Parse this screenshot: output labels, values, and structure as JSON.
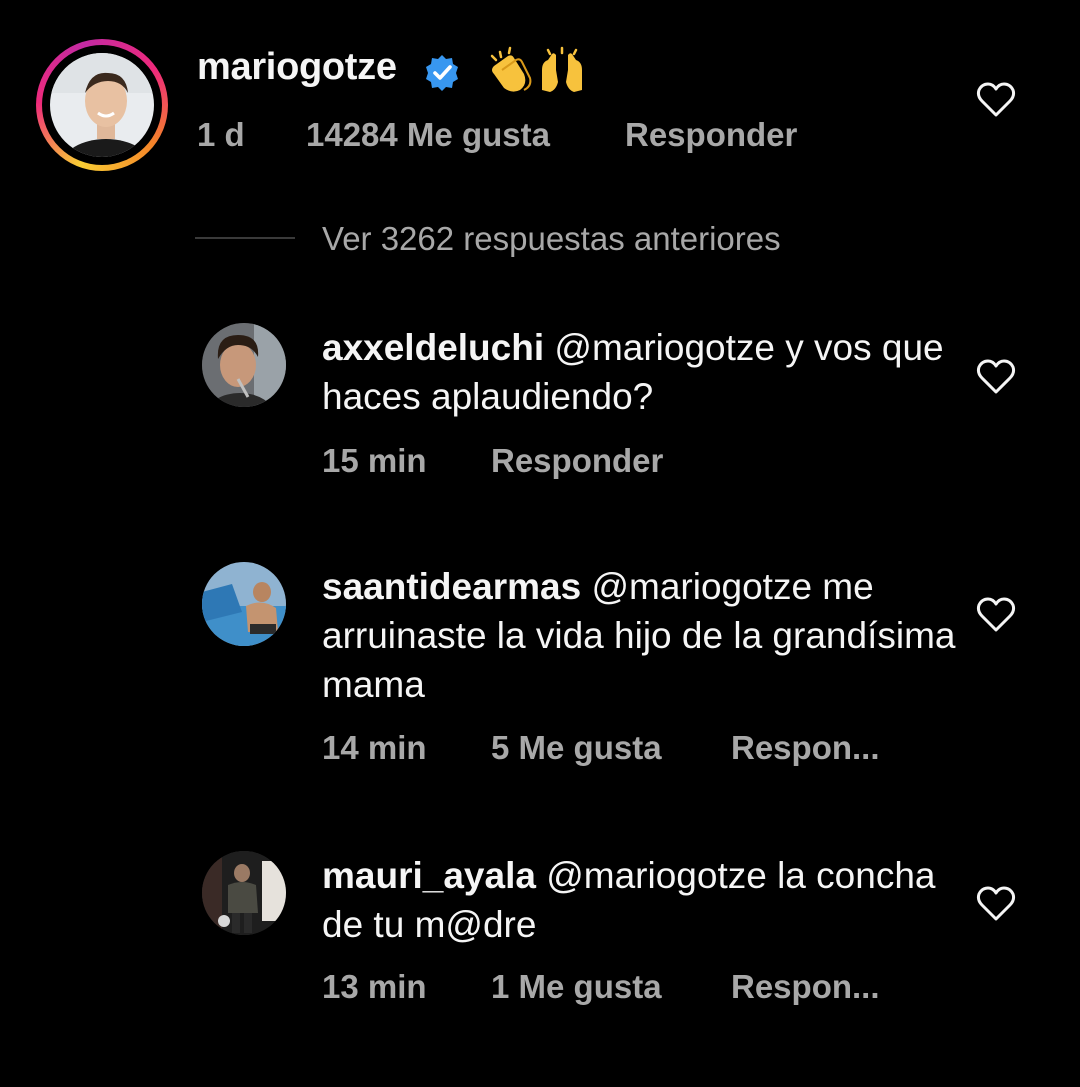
{
  "top_comment": {
    "username": "mariogotze",
    "verified_icon": "verified-badge-icon",
    "emojis": "clapping-hands-and-raised-hands-emoji",
    "time": "1 d",
    "likes": "14284 Me gusta",
    "reply": "Responder",
    "heart_icon": "heart-outline-icon"
  },
  "view_replies": "Ver 3262 respuestas anteriores",
  "replies": [
    {
      "username": "axxeldeluchi",
      "text": "@mariogotze y vos que haces aplaudiendo?",
      "time": "15 min",
      "likes": "",
      "reply": "Responder"
    },
    {
      "username": "saantidearmas",
      "text": "@mariogotze me arruinaste la vida hijo de la grandísima mama",
      "time": "14 min",
      "likes": "5 Me gusta",
      "reply": "Respon..."
    },
    {
      "username": "mauri_ayala",
      "text": "@mariogotze la concha de tu m@dre",
      "time": "13 min",
      "likes": "1 Me gusta",
      "reply": "Respon..."
    }
  ],
  "colors": {
    "background": "#000000",
    "text_primary": "#f5f5f5",
    "text_secondary": "#a8a8a8",
    "verified_blue": "#3897f0"
  }
}
